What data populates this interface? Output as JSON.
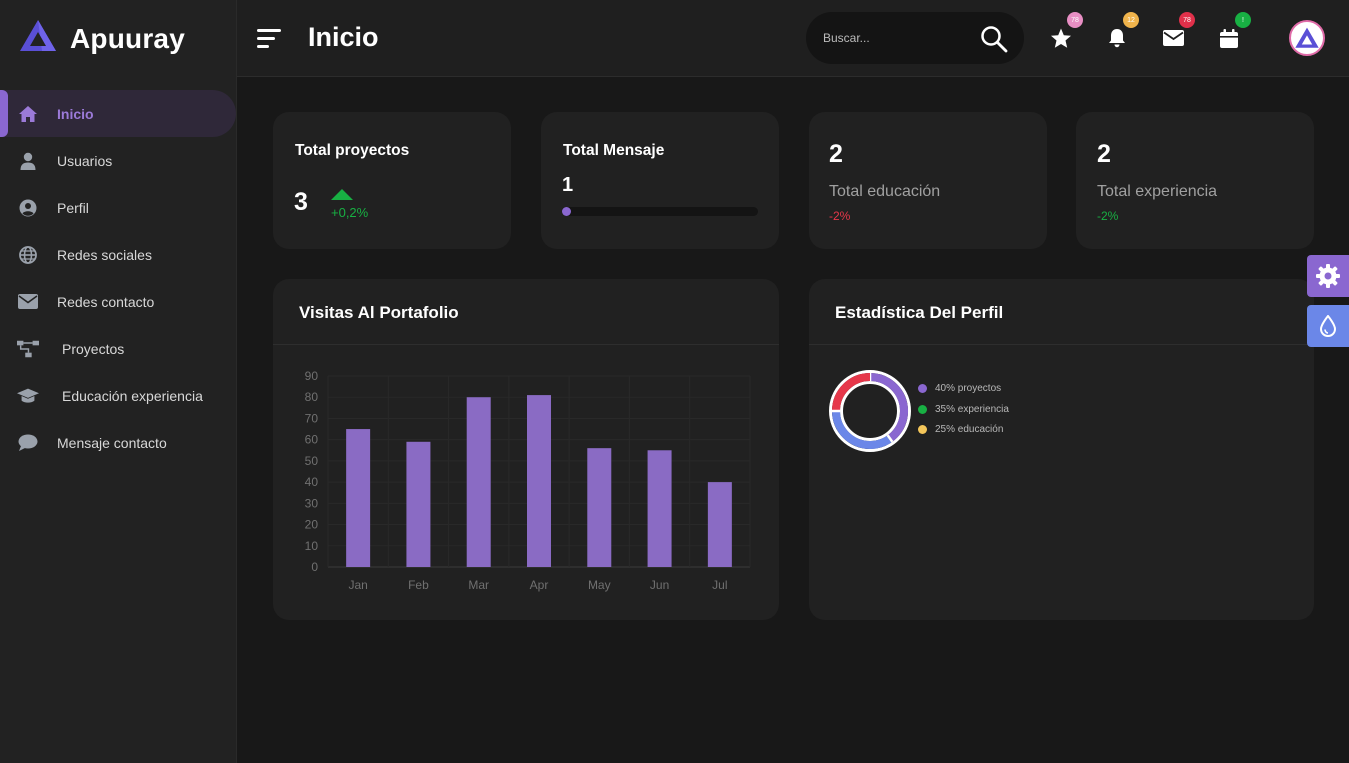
{
  "app": {
    "brand": "Apuuray"
  },
  "sidebar": {
    "items": [
      {
        "label": "Inicio",
        "icon": "home-icon",
        "active": true
      },
      {
        "label": "Usuarios",
        "icon": "user-icon"
      },
      {
        "label": "Perfil",
        "icon": "user-circle-icon"
      },
      {
        "label": "Redes sociales",
        "icon": "globe-icon"
      },
      {
        "label": "Redes contacto",
        "icon": "envelope-icon"
      },
      {
        "label": "Proyectos",
        "icon": "sitemap-icon"
      },
      {
        "label": "Educación experiencia",
        "icon": "graduation-cap-icon"
      },
      {
        "label": "Mensaje contacto",
        "icon": "comment-icon"
      }
    ]
  },
  "header": {
    "title": "Inicio",
    "search_placeholder": "Buscar...",
    "badges": {
      "star": "78",
      "bell": "12",
      "mail": "78",
      "calendar": "!"
    }
  },
  "colors": {
    "accent": "#8a67d0",
    "blue": "#6b87e8",
    "red": "#e6374a",
    "green": "#18b043",
    "yellow": "#f4c65a"
  },
  "stats": {
    "proyectos": {
      "title": "Total proyectos",
      "value": "3",
      "change": "+0,2%"
    },
    "mensaje": {
      "title": "Total Mensaje",
      "value": "1",
      "progress": 0.03
    },
    "educacion": {
      "value": "2",
      "label": "Total educación",
      "change": "-2%"
    },
    "experiencia": {
      "value": "2",
      "label": "Total experiencia",
      "change": "-2%"
    }
  },
  "visits": {
    "title": "Visitas Al Portafolio"
  },
  "profile_stats": {
    "title": "Estadística Del Perfil"
  },
  "chart_data": [
    {
      "type": "bar",
      "title": "Visitas Al Portafolio",
      "categories": [
        "Jan",
        "Feb",
        "Mar",
        "Apr",
        "May",
        "Jun",
        "Jul"
      ],
      "values": [
        65,
        59,
        80,
        81,
        56,
        55,
        40
      ],
      "ylim": [
        0,
        90
      ],
      "yticks": [
        0,
        10,
        20,
        30,
        40,
        50,
        60,
        70,
        80,
        90
      ],
      "color": "#8a6bc4",
      "grid": true
    },
    {
      "type": "pie",
      "title": "Estadística Del Perfil",
      "donut": true,
      "slices": [
        {
          "label": "40% proyectos",
          "value": 40,
          "color": "#8a67d0"
        },
        {
          "label": "35% experiencia",
          "value": 35,
          "color": "#6b87e8"
        },
        {
          "label": "25% educación",
          "value": 25,
          "color": "#e6374a"
        }
      ],
      "legend": [
        {
          "label": "40% proyectos",
          "color": "#8a67d0"
        },
        {
          "label": "35% experiencia",
          "color": "#18b043"
        },
        {
          "label": "25% educación",
          "color": "#f4c65a"
        }
      ],
      "legend_position": "right"
    }
  ]
}
